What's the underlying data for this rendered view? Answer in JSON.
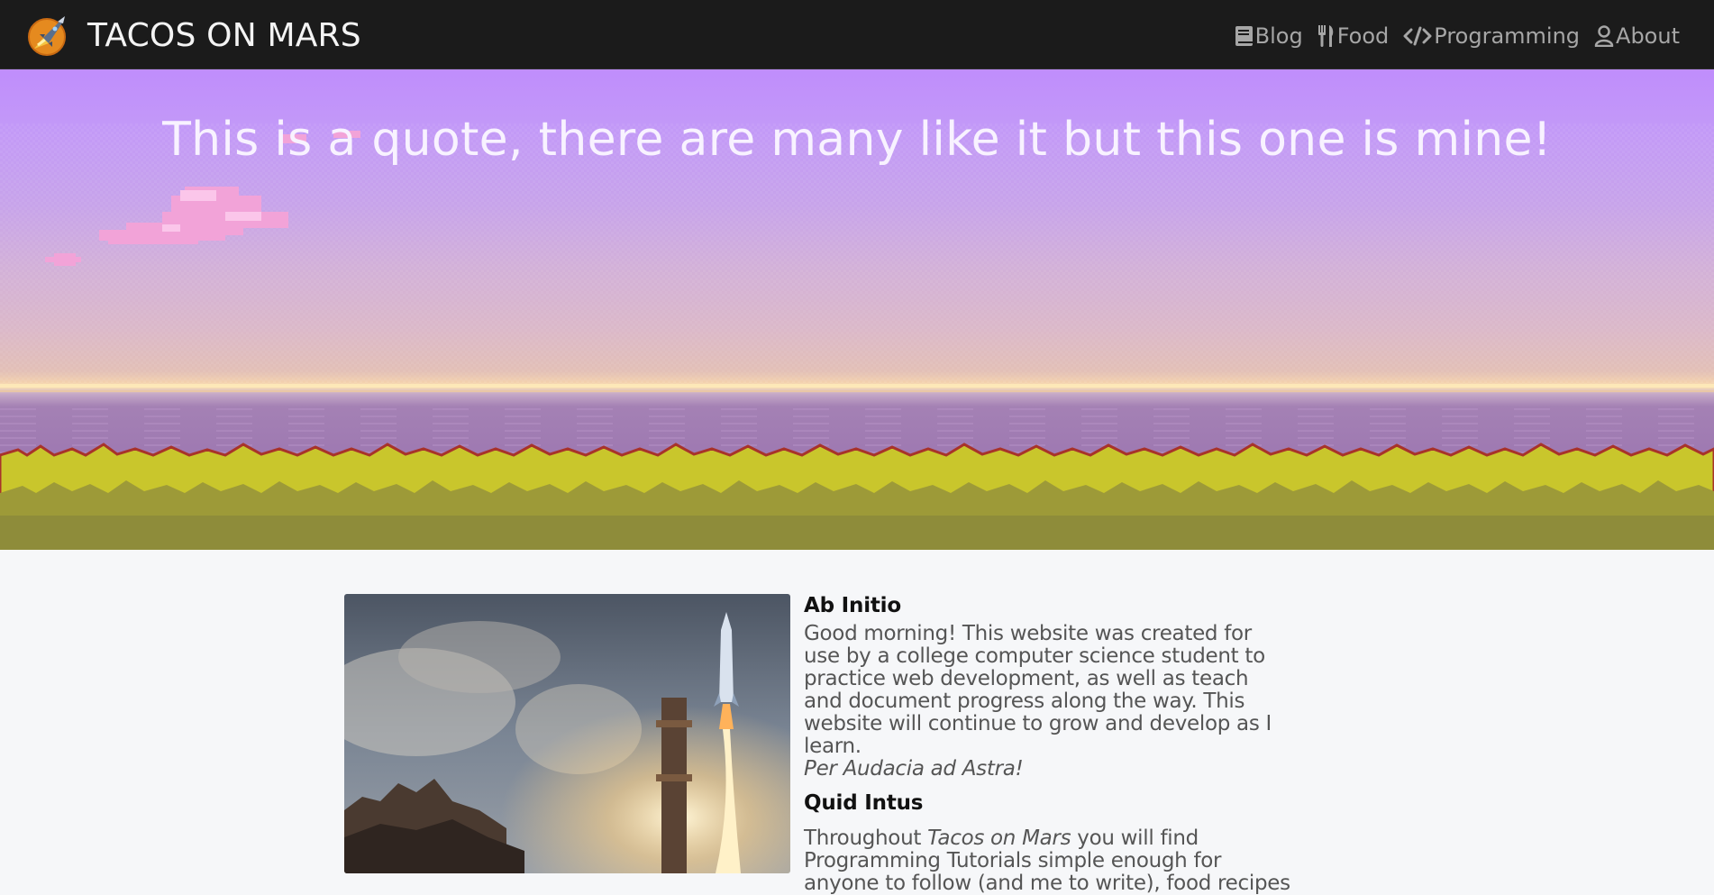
{
  "navbar": {
    "brand_name": "TACOS ON MARS",
    "links": [
      {
        "label": "Blog",
        "icon": "book-icon"
      },
      {
        "label": "Food",
        "icon": "utensils-icon"
      },
      {
        "label": "Programming",
        "icon": "code-icon"
      },
      {
        "label": "About",
        "icon": "user-icon"
      }
    ]
  },
  "hero": {
    "quote": "This is a quote, there are many like it but this one is mine!"
  },
  "content": {
    "section1": {
      "heading": "Ab Initio",
      "body": "Good morning! This website was created for use by a college computer science student to practice web development, as well as teach and document progress along the way. This website will continue to grow and develop as I learn.",
      "motto": "Per Audacia ad Astra!"
    },
    "section2": {
      "heading": "Quid Intus",
      "body_prefix": "Throughout ",
      "body_site": "Tacos on Mars",
      "body_suffix": " you will find Programming Tutorials simple enough for anyone to follow (and me to write), food recipes"
    }
  },
  "colors": {
    "navbar_bg": "#1b1b1b",
    "nav_link": "#a6a6a6",
    "hero_sky_top": "#c08dfc",
    "hero_water": "#9f7ab2",
    "grass": "#c9c62c",
    "page_bg": "#f6f7f9"
  }
}
